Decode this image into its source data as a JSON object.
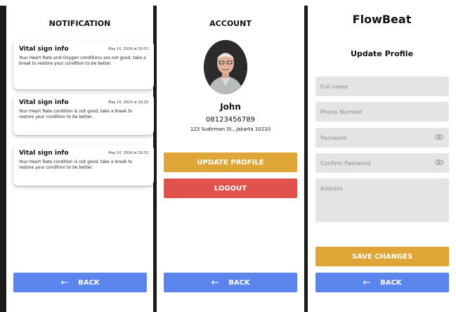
{
  "notification": {
    "title": "NOTIFICATION",
    "cards": [
      {
        "title": "Vital sign info",
        "date": "May 10, 2024 at 20:23",
        "body": "Your Heart Rate and Oxygen conditions are not good, take a break to restore your condition to be better."
      },
      {
        "title": "Vital sign info",
        "date": "May 10, 2024 at 20:23",
        "body": "Your Heart Rate condition is not good, take a break to restore your condition to be better."
      },
      {
        "title": "Vital sign info",
        "date": "May 10, 2024 at 20:23",
        "body": "Your Heart Rate condition is not good, take a break to restore your condition to be better."
      }
    ],
    "back_label": "BACK"
  },
  "account": {
    "title": "ACCOUNT",
    "name": "John",
    "phone": "08123456789",
    "address": "123 Sudirman St., Jakarta 10210",
    "update_label": "UPDATE PROFILE",
    "logout_label": "LOGOUT",
    "back_label": "BACK"
  },
  "profile": {
    "brand": "FlowBeat",
    "title": "Update Profile",
    "fields": {
      "full_name": "Full name",
      "phone": "Phone Number",
      "password": "Password",
      "confirm_password": "Confirm Password",
      "address": "Address"
    },
    "save_label": "SAVE CHANGES",
    "back_label": "BACK"
  },
  "colors": {
    "primary_blue": "#5b84ec",
    "accent_yellow": "#dfa637",
    "danger_red": "#e2524c",
    "field_gray": "#e4e4e4"
  },
  "icons": {
    "back": "arrow-left-icon",
    "visibility": "eye-icon",
    "avatar": "user-photo"
  }
}
